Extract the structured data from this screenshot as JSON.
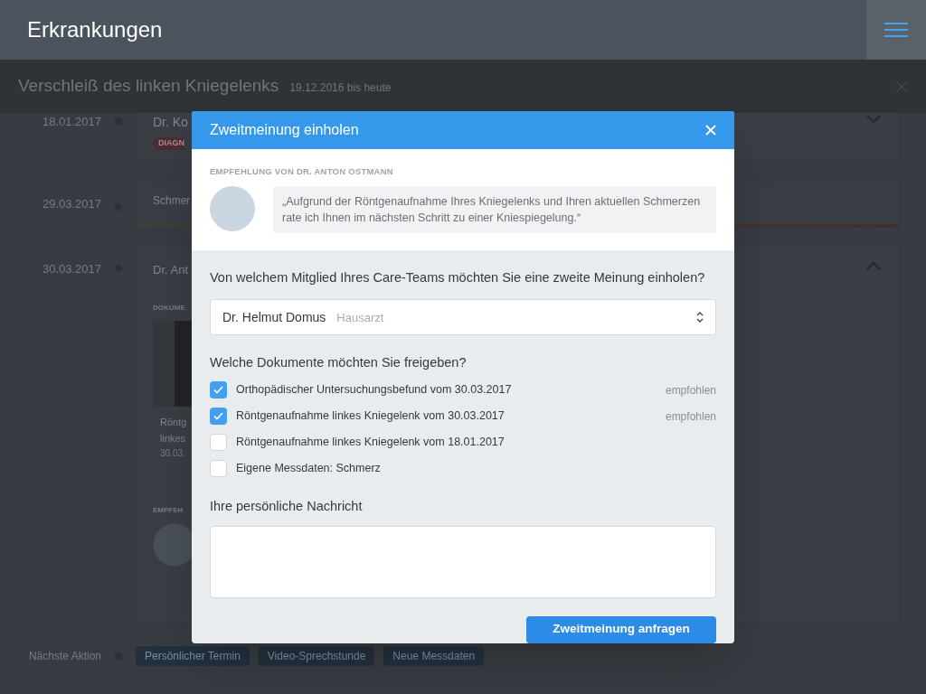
{
  "header": {
    "title": "Erkrankungen"
  },
  "condition": {
    "title": "Verschleiß des linken Kniegelenks",
    "period": "19.12.2016 bis heute"
  },
  "timeline": [
    {
      "kind": "doctor",
      "date": "18.01.2017",
      "doctor": "Dr. Ko",
      "tag": "DIAGN",
      "expanded": false
    },
    {
      "kind": "measure",
      "date": "29.03.2017",
      "label": "Schmer"
    },
    {
      "kind": "detail",
      "date": "30.03.2017",
      "doctor": "Dr. Ant",
      "expanded": true,
      "documents_label": "DOKUME",
      "document_title": "Röntg",
      "document_title_2": "linkes",
      "document_date": "30.03.",
      "recommendation_label": "EMPFEH"
    }
  ],
  "next_action": {
    "label": "Nächste Aktion",
    "buttons": [
      "Persönlicher Termin",
      "Video-Sprechstunde",
      "Neue Messdaten"
    ]
  },
  "dialog": {
    "title": "Zweitmeinung einholen",
    "recommendation_label": "EMPFEHLUNG VON DR. ANTON OSTMANN",
    "quote": "„Aufgrund der Röntgenaufnahme Ihres Kniegelenks und Ihren aktuellen Schmerzen rate ich Ihnen im nächsten Schritt zu einer Kniespiegelung.“",
    "question": "Von welchem Mitglied Ihres Care-Teams möchten Sie eine zweite Meinung einholen?",
    "select": {
      "value": "Dr. Helmut Domus",
      "role": "Hausarzt"
    },
    "documents_label": "Welche Dokumente möchten Sie freigeben?",
    "documents": [
      {
        "label": "Orthopädischer Untersuchungsbefund vom 30.03.2017",
        "checked": true,
        "badge": "empfohlen"
      },
      {
        "label": "Röntgenaufnahme linkes Kniegelenk vom 30.03.2017",
        "checked": true,
        "badge": "empfohlen"
      },
      {
        "label": "Röntgenaufnahme linkes Kniegelenk vom 18.01.2017",
        "checked": false
      },
      {
        "label": "Eigene Messdaten: Schmerz",
        "checked": false
      }
    ],
    "message_label": "Ihre persönliche Nachricht",
    "submit": "Zweitmeinung anfragen"
  }
}
